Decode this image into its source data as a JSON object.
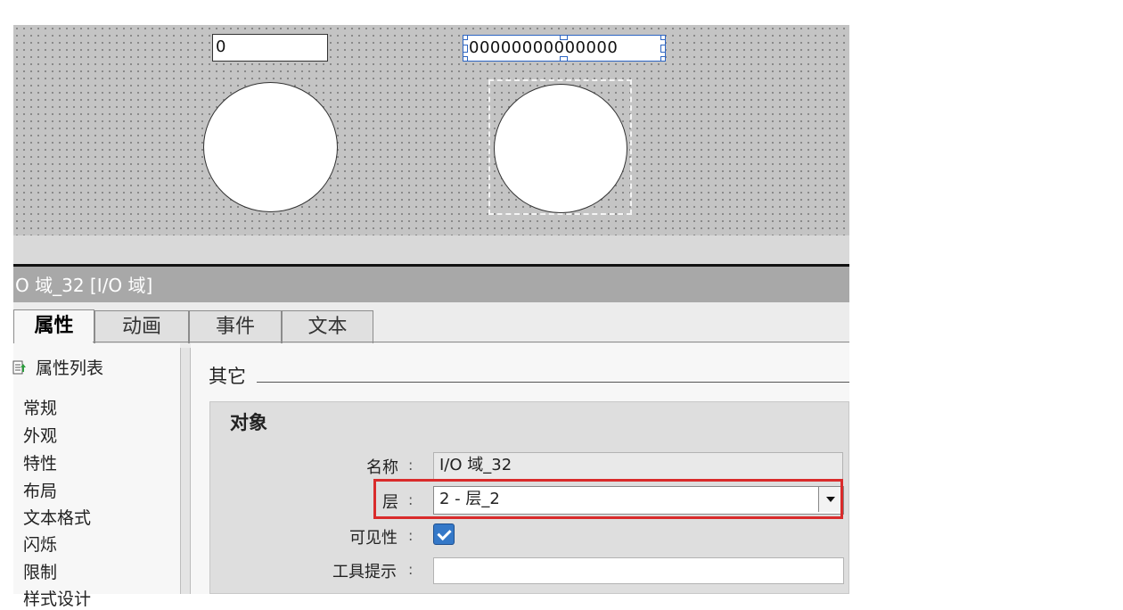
{
  "canvas": {
    "io_left_value": "0",
    "io_right_value": "00000000000000"
  },
  "panel": {
    "title": "O 域_32 [I/O 域]",
    "tabs": [
      "属性",
      "动画",
      "事件",
      "文本"
    ],
    "nav": {
      "list_label": "属性列表",
      "items": [
        "常规",
        "外观",
        "特性",
        "布局",
        "文本格式",
        "闪烁",
        "限制",
        "样式设计"
      ]
    },
    "content": {
      "section_title": "其它",
      "group_title": "对象",
      "name_label": "名称",
      "name_value": "I/O 域_32",
      "layer_label": "层",
      "layer_value": "2 - 层_2",
      "visible_label": "可见性",
      "visible_checked": true,
      "tooltip_label": "工具提示",
      "tooltip_value": "",
      "colon": ":"
    }
  },
  "colors": {
    "highlight": "#d92b2b",
    "selection": "#2d65c2",
    "checkbox": "#3478c8"
  }
}
